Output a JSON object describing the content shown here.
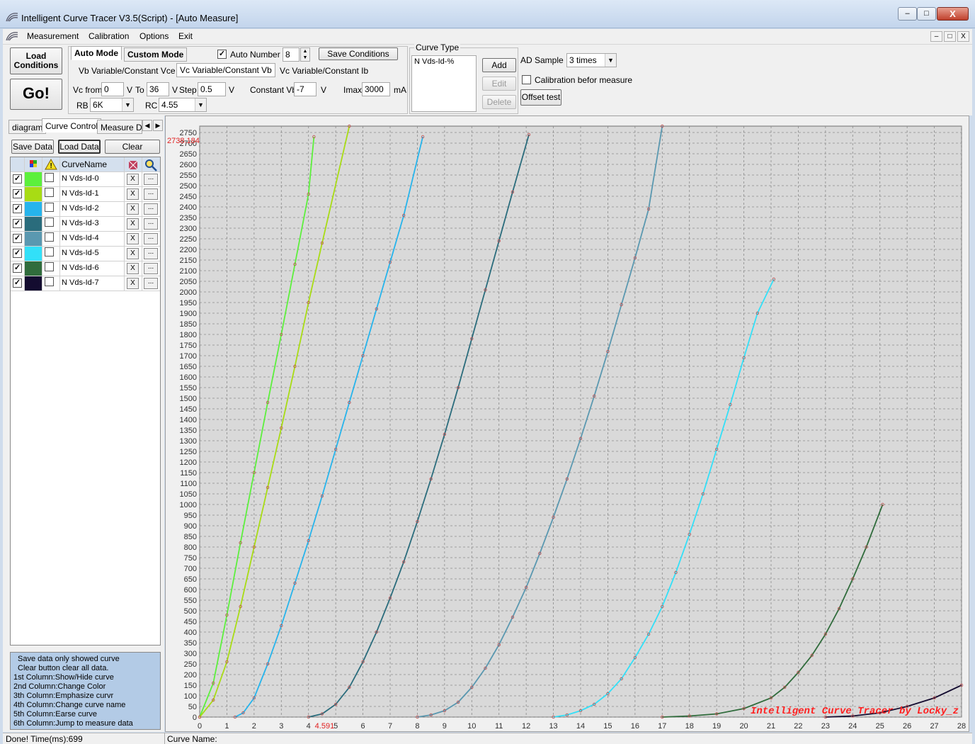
{
  "window": {
    "title": "Intelligent Curve Tracer V3.5(Script) - [Auto Measure]",
    "minimize": "–",
    "restore": "□",
    "close": "X"
  },
  "menu": {
    "items": [
      "Measurement",
      "Calibration",
      "Options",
      "Exit"
    ],
    "mdi_minimize": "–",
    "mdi_restore": "□",
    "mdi_close": "X"
  },
  "toolbar": {
    "load_conditions": "Load Conditions",
    "go": "Go!",
    "mode_tabs": [
      "Auto Mode",
      "Custom Mode"
    ],
    "auto_number_label": "Auto Number",
    "auto_number_checked": true,
    "auto_number_value": "8",
    "save_conditions": "Save Conditions",
    "sub_tabs": [
      "Vb Variable/Constant Vce",
      "Vc Variable/Constant Vb",
      "Vc Variable/Constant Ib"
    ],
    "vc_from_label": "Vc from",
    "vc_from_value": "0",
    "v1": "V",
    "to_label": "To",
    "to_value": "36",
    "v2": "V",
    "step_label": "Step",
    "step_value": "0.5",
    "v3": "V",
    "constant_vb_label": "Constant Vb",
    "constant_vb_value": "-7",
    "v4": "V",
    "imax_label": "Imax",
    "imax_value": "3000",
    "imax_unit": "mA",
    "rb_label": "RB",
    "rb_value": "6K",
    "rc_label": "RC",
    "rc_value": "4.55",
    "curve_type_label": "Curve Type",
    "curve_type_value": "N Vds-Id-%",
    "add": "Add",
    "edit": "Edit",
    "delete": "Delete",
    "ad_sample_label": "AD Sample",
    "ad_sample_value": "3 times",
    "calibration_label": "Calibration befor measure",
    "calibration_checked": false,
    "offset_test": "Offset test"
  },
  "left": {
    "tabs": [
      "diagram",
      "Curve Control",
      "Measure Da"
    ],
    "save_data": "Save Data",
    "load_data": "Load Data",
    "clear": "Clear",
    "col_name": "CurveName",
    "curves": [
      {
        "name": "N Vds-Id-0",
        "color": "#5cf03c",
        "shown": true
      },
      {
        "name": "N Vds-Id-1",
        "color": "#a8dc14",
        "shown": true
      },
      {
        "name": "N Vds-Id-2",
        "color": "#26b4ec",
        "shown": true
      },
      {
        "name": "N Vds-Id-3",
        "color": "#2a6c7c",
        "shown": true
      },
      {
        "name": "N Vds-Id-4",
        "color": "#5a98b0",
        "shown": true
      },
      {
        "name": "N Vds-Id-5",
        "color": "#32e0f8",
        "shown": true
      },
      {
        "name": "N Vds-Id-6",
        "color": "#306c3c",
        "shown": true
      },
      {
        "name": "N Vds-Id-7",
        "color": "#140c30",
        "shown": true
      }
    ],
    "x_label": "X",
    "dots_label": "...",
    "help": [
      "Save data only showed curve",
      "Clear button clear all data.",
      "1st Column:Show/Hide curve",
      "2nd Column:Change Color",
      "3th Column:Emphasize curvr",
      "4th Column:Change curve name",
      "5th Column:Earse curve",
      "6th Column:Jump to measure data"
    ]
  },
  "chart_data": {
    "type": "line",
    "xlim": [
      0,
      28
    ],
    "ylim": [
      0,
      2780
    ],
    "x_ticks": [
      0,
      1,
      2,
      3,
      4,
      5,
      6,
      7,
      8,
      9,
      10,
      11,
      12,
      13,
      14,
      15,
      16,
      17,
      18,
      19,
      20,
      21,
      22,
      23,
      24,
      25,
      26,
      27,
      28
    ],
    "y_ticks": [
      0,
      50,
      100,
      150,
      200,
      250,
      300,
      350,
      400,
      450,
      500,
      550,
      600,
      650,
      700,
      750,
      800,
      850,
      900,
      950,
      1000,
      1050,
      1100,
      1150,
      1200,
      1250,
      1300,
      1350,
      1400,
      1450,
      1500,
      1550,
      1600,
      1650,
      1700,
      1750,
      1800,
      1850,
      1900,
      1950,
      2000,
      2050,
      2100,
      2150,
      2200,
      2250,
      2300,
      2350,
      2400,
      2450,
      2500,
      2550,
      2600,
      2650,
      2700,
      2750
    ],
    "cursor_y_label": "2738.184",
    "cursor_x_label": "4.591",
    "watermark": "Intelligent Curve Tracer by Locky_z",
    "grid": true,
    "series": [
      {
        "color": "#5cf03c",
        "x": [
          0,
          0.5,
          1,
          1.5,
          2,
          2.5,
          3,
          3.5,
          4,
          4.2
        ],
        "y": [
          0,
          160,
          480,
          820,
          1150,
          1480,
          1800,
          2130,
          2460,
          2730
        ]
      },
      {
        "color": "#a8dc14",
        "x": [
          0,
          0.5,
          1,
          1.5,
          2,
          2.5,
          3,
          3.5,
          4,
          4.5,
          5.5
        ],
        "y": [
          0,
          80,
          260,
          520,
          800,
          1080,
          1360,
          1650,
          1950,
          2230,
          2780
        ]
      },
      {
        "color": "#26b4ec",
        "x": [
          1.3,
          1.6,
          2,
          2.5,
          3,
          3.5,
          4,
          4.5,
          5,
          5.5,
          6,
          6.5,
          7,
          7.5,
          8.2
        ],
        "y": [
          0,
          20,
          90,
          250,
          430,
          630,
          830,
          1040,
          1260,
          1480,
          1700,
          1920,
          2140,
          2360,
          2730
        ]
      },
      {
        "color": "#2a6c7c",
        "x": [
          4,
          4.5,
          5,
          5.5,
          6,
          6.5,
          7,
          7.5,
          8,
          8.5,
          9,
          9.5,
          10,
          10.5,
          11,
          11.5,
          12.1
        ],
        "y": [
          0,
          15,
          60,
          140,
          260,
          400,
          560,
          730,
          920,
          1120,
          1330,
          1550,
          1780,
          2010,
          2240,
          2470,
          2740
        ]
      },
      {
        "color": "#5a98b0",
        "x": [
          8,
          8.5,
          9,
          9.5,
          10,
          10.5,
          11,
          11.5,
          12,
          12.5,
          13,
          13.5,
          14,
          14.5,
          15,
          15.5,
          16,
          16.5,
          17
        ],
        "y": [
          0,
          10,
          30,
          70,
          140,
          230,
          340,
          470,
          610,
          770,
          940,
          1120,
          1310,
          1510,
          1720,
          1940,
          2160,
          2390,
          2780
        ]
      },
      {
        "color": "#32e0f8",
        "x": [
          13,
          13.5,
          14,
          14.5,
          15,
          15.5,
          16,
          16.5,
          17,
          17.5,
          18,
          18.5,
          19,
          19.5,
          20,
          20.5,
          21.1
        ],
        "y": [
          0,
          10,
          30,
          60,
          110,
          180,
          280,
          390,
          520,
          680,
          860,
          1050,
          1260,
          1470,
          1690,
          1900,
          2060
        ]
      },
      {
        "color": "#306c3c",
        "x": [
          17,
          18,
          19,
          20,
          21,
          21.5,
          22,
          22.5,
          23,
          23.5,
          24,
          24.5,
          25.1
        ],
        "y": [
          0,
          5,
          15,
          40,
          90,
          140,
          210,
          290,
          390,
          510,
          650,
          800,
          1000
        ]
      },
      {
        "color": "#140c30",
        "x": [
          23,
          24,
          25,
          26,
          27,
          28
        ],
        "y": [
          0,
          5,
          20,
          50,
          90,
          150
        ]
      }
    ]
  },
  "status": {
    "left": "Done!  Time(ms):699",
    "right": "Curve Name:"
  }
}
